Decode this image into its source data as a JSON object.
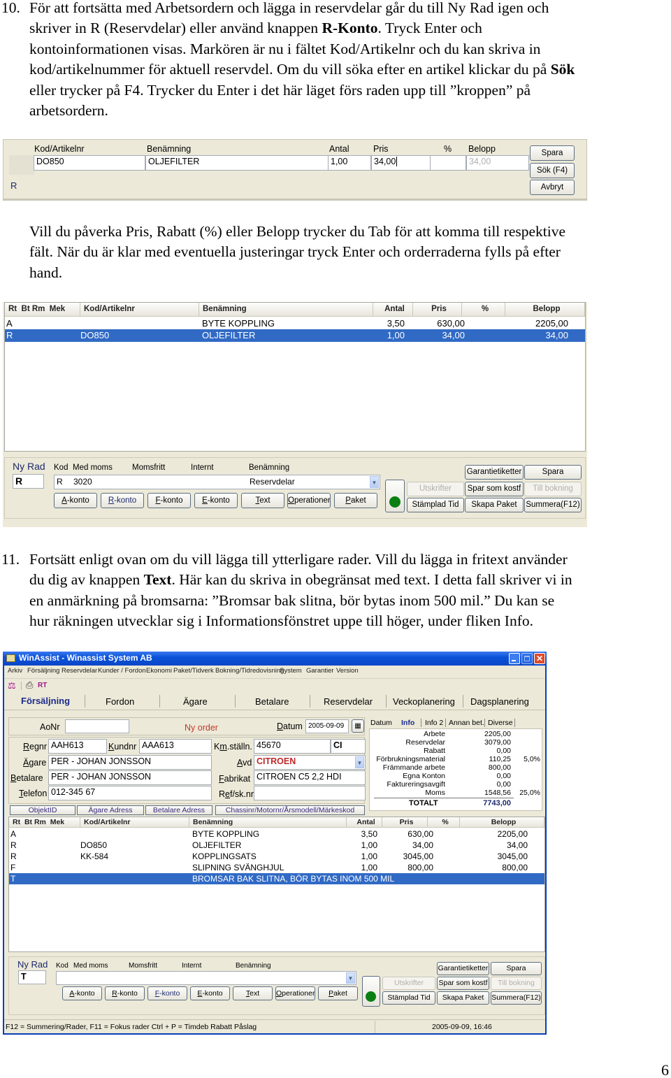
{
  "page_number": "6",
  "step10": {
    "number": "10.",
    "lines": [
      "För att fortsätta med Arbetsordern och lägga in reservdelar går du till Ny Rad igen och",
      "skriver in R (Reservdelar) eller använd knappen",
      "R-Konto",
      ". Tryck Enter och",
      "kontoinformationen visas. Markören är nu i fältet Kod/Artikelnr och du kan skriva in",
      "kod/artikelnummer för aktuell reservdel. Om du vill söka efter en artikel klickar du på",
      "Sök",
      "eller trycker på F4. Trycker du Enter i det här läget förs raden upp till ”kroppen” på",
      "arbetsordern."
    ]
  },
  "entry_panel": {
    "headers": [
      "Kod/Artikelnr",
      "Benämning",
      "Antal",
      "Pris",
      "%",
      "Belopp"
    ],
    "values": {
      "kod": "DO850",
      "benamning": "OLJEFILTER",
      "antal": "1,00",
      "pris": "34,00",
      "procent": "",
      "belopp": "34,00"
    },
    "row_type": "R",
    "buttons": {
      "spara": "Spara",
      "sok": "Sök (F4)",
      "avbryt": "Avbryt"
    }
  },
  "middle_paragraph": [
    "Vill du påverka Pris, Rabatt (%) eller Belopp trycker du Tab för att komma till respektive",
    "fält. När du är klar med eventuella justeringar tryck Enter och orderraderna fylls på efter",
    "hand."
  ],
  "order_table_1": {
    "headers": {
      "rt": "Rt",
      "bt": "Bt",
      "rm": "Rm",
      "mek": "Mek",
      "kod": "Kod/Artikelnr",
      "benamning": "Benämning",
      "antal": "Antal",
      "pris": "Pris",
      "procent": "%",
      "belopp": "Belopp"
    },
    "rows": [
      {
        "rt": "A",
        "kod": "",
        "benamning": "BYTE KOPPLING",
        "antal": "3,50",
        "pris": "630,00",
        "procent": "",
        "belopp": "2205,00",
        "selected": false
      },
      {
        "rt": "R",
        "kod": "DO850",
        "benamning": "OLJEFILTER",
        "antal": "1,00",
        "pris": "34,00",
        "procent": "",
        "belopp": "34,00",
        "selected": true
      }
    ]
  },
  "newrow_panel_1": {
    "ny_rad_label": "Ny Rad",
    "ny_rad_value": "R",
    "col_labels": {
      "kod": "Kod",
      "med_moms": "Med moms",
      "momsfritt": "Momsfritt",
      "internt": "Internt",
      "benamning": "Benämning"
    },
    "combo": {
      "kod": "R",
      "konto": "3020",
      "benamning": "Reservdelar"
    },
    "account_buttons": [
      "A-konto",
      "R-konto",
      "F-konto",
      "E-konto",
      "Text",
      "Operationer",
      "Paket"
    ],
    "status_color": "#0a7f12",
    "action_buttons": {
      "garantietiketter": "Garantietiketter",
      "spara": "Spara",
      "utskrifter": "Utskrifter",
      "spar_som_kostf": "Spar som kostf",
      "till_bokning": "Till bokning",
      "stamplad_tid": "Stämplad Tid",
      "skapa_paket": "Skapa Paket",
      "summera": "Summera(F12)"
    }
  },
  "step11": {
    "number": "11.",
    "line1": "Fortsätt enligt ovan om du vill lägga till ytterligare rader. Vill du lägga in fritext använder",
    "line2a": "du dig av knappen",
    "line2b": "Text",
    "line2c": ". Här kan du skriva in obegränsat med text. I detta fall skriver vi in",
    "line3": "en anmärkning på bromsarna: ”Bromsar bak slitna, bör bytas inom 500 mil.” Du kan se",
    "line4": "hur räkningen utvecklar sig i Informationsfönstret uppe till höger, under fliken Info."
  },
  "app": {
    "title": "WinAssist - Winassist System AB",
    "menu": [
      "Arkiv",
      "Försäljning",
      "Reservdelar",
      "Kunder / Fordon",
      "Ekonomi",
      "Paket/Tidverk",
      "Bokning/Tidredovisning",
      "System",
      "Garantier",
      "Version"
    ],
    "toolbar_rt": "RT",
    "tabs": [
      "Försäljning",
      "Fordon",
      "Ägare",
      "Betalare",
      "Reservdelar",
      "Veckoplanering",
      "Dagsplanering"
    ],
    "active_tab": "Försäljning",
    "order": {
      "aonr_label": "AoNr",
      "aonr_value": "",
      "status": "Ny order",
      "datum_label": "Datum",
      "datum_value": "2005-09-09",
      "regnr_label": "Regnr",
      "regnr": "AAH613",
      "kundnr_label": "Kundnr",
      "kundnr": "AAA613",
      "km_label": "Km.ställn.",
      "km": "45670",
      "km_code": "CI",
      "agare_label": "Ägare",
      "agare": "PER - JOHAN JONSSON",
      "avd_label": "Avd",
      "avd": "CITROEN",
      "betalare_label": "Betalare",
      "betalare": "PER - JOHAN JONSSON",
      "fabrikat_label": "Fabrikat",
      "fabrikat": "CITROEN C5 2,2 HDI",
      "telefon_label": "Telefon",
      "telefon": "012-345 67",
      "ref_label": "Ref/sk.nr",
      "ref": "",
      "subtabs": [
        "ObjektID",
        "Ägare Adress",
        "Betalare Adress",
        "Chassinr/Motornr/Årsmodell/Märkeskod"
      ]
    },
    "info_panel": {
      "tabs": [
        "Datum",
        "Info",
        "Info 2",
        "Annan bet.",
        "Diverse"
      ],
      "active_tab": "Info",
      "rows": [
        {
          "label": "Arbete",
          "value": "2205,00",
          "pct": ""
        },
        {
          "label": "Reservdelar",
          "value": "3079,00",
          "pct": ""
        },
        {
          "label": "Rabatt",
          "value": "0,00",
          "pct": ""
        },
        {
          "label": "Förbrukningsmaterial",
          "value": "110,25",
          "pct": "5,0%"
        },
        {
          "label": "Främmande arbete",
          "value": "800,00",
          "pct": ""
        },
        {
          "label": "Egna Konton",
          "value": "0,00",
          "pct": ""
        },
        {
          "label": "Faktureringsavgift",
          "value": "0,00",
          "pct": ""
        },
        {
          "label": "Moms",
          "value": "1548,56",
          "pct": "25,0%"
        }
      ],
      "total_label": "TOTALT",
      "total_value": "7743,00"
    },
    "table": {
      "headers": {
        "rt": "Rt",
        "bt": "Bt",
        "rm": "Rm",
        "mek": "Mek",
        "kod": "Kod/Artikelnr",
        "benamning": "Benämning",
        "antal": "Antal",
        "pris": "Pris",
        "procent": "%",
        "belopp": "Belopp"
      },
      "rows": [
        {
          "rt": "A",
          "kod": "",
          "benamning": "BYTE KOPPLING",
          "antal": "3,50",
          "pris": "630,00",
          "belopp": "2205,00"
        },
        {
          "rt": "R",
          "kod": "DO850",
          "benamning": "OLJEFILTER",
          "antal": "1,00",
          "pris": "34,00",
          "belopp": "34,00"
        },
        {
          "rt": "R",
          "kod": "KK-584",
          "benamning": "KOPPLINGSATS",
          "antal": "1,00",
          "pris": "3045,00",
          "belopp": "3045,00"
        },
        {
          "rt": "F",
          "kod": "",
          "benamning": "SLIPNING SVÄNGHJUL",
          "antal": "1,00",
          "pris": "800,00",
          "belopp": "800,00"
        },
        {
          "rt": "T",
          "kod": "",
          "benamning": "BROMSAR BAK SLITNA, BÖR BYTAS INOM 500 MIL",
          "antal": "",
          "pris": "",
          "belopp": ""
        }
      ],
      "selected_row": 4
    },
    "newrow": {
      "ny_rad_label": "Ny Rad",
      "ny_rad_value": "T",
      "col_labels": {
        "kod": "Kod",
        "med_moms": "Med moms",
        "momsfritt": "Momsfritt",
        "internt": "Internt",
        "benamning": "Benämning"
      },
      "account_buttons": [
        "A-konto",
        "R-konto",
        "F-konto",
        "E-konto",
        "Text",
        "Operationer",
        "Paket"
      ],
      "action_buttons": {
        "garantietiketter": "Garantietiketter",
        "spara": "Spara",
        "utskrifter": "Utskrifter",
        "spar_som_kostf": "Spar som kostf",
        "till_bokning": "Till bokning",
        "stamplad_tid": "Stämplad Tid",
        "skapa_paket": "Skapa Paket",
        "summera": "Summera(F12)"
      }
    },
    "statusbar": {
      "hints": "F12 = Summering/Rader, F11 = Fokus rader  Ctrl + P = Timdeb Rabatt Påslag",
      "datetime": "2005-09-09, 16:46"
    }
  }
}
